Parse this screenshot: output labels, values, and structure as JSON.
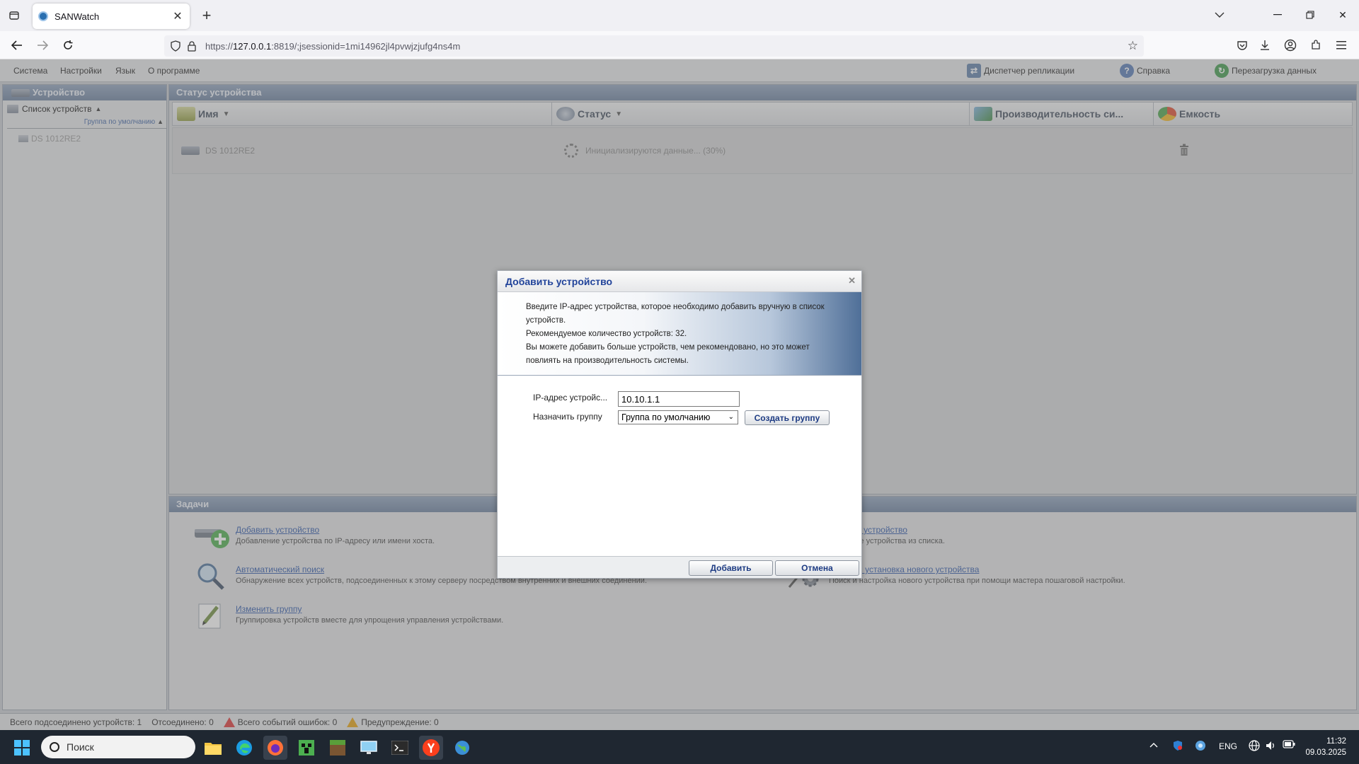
{
  "browser": {
    "tab_title": "SANWatch",
    "url_prefix": "https://",
    "url_host": "127.0.0.1",
    "url_rest": ":8819/;jsessionid=1mi14962jl4pvwjzjufg4ns4m"
  },
  "menu": {
    "items": [
      "Система",
      "Настройки",
      "Язык",
      "О программе"
    ],
    "replication": "Диспетчер репликации",
    "help": "Справка",
    "reload": "Перезагрузка данных"
  },
  "left_panel": {
    "title": "Устройство",
    "tree_root": "Список устройств",
    "group": "Группа по умолчанию",
    "device": "DS 1012RE2"
  },
  "status_panel": {
    "title": "Статус устройства",
    "columns": [
      "Имя",
      "Статус",
      "Производительность си...",
      "Емкость"
    ],
    "row": {
      "name": "DS 1012RE2",
      "status": "Инициализируются данные... (30%)"
    }
  },
  "tasks": {
    "title": "Задачи",
    "items": [
      {
        "link": "Добавить устройство",
        "desc": "Добавление устройства по IP-адресу или имени хоста."
      },
      {
        "link": "Автоматический поиск",
        "desc": "Обнаружение всех устройств, подсоединенных к этому серверу посредством внутренних и внешних соединений."
      },
      {
        "link": "Изменить группу",
        "desc": "Группировка устройств вместе для упрощения управления устройствами."
      },
      {
        "link": "Удалить устройство",
        "desc": "Удаление устройства из списка."
      },
      {
        "link": "Быстрая установка нового устройства",
        "desc": "Поиск и настройка нового устройства при помощи мастера пошаговой настройки."
      }
    ]
  },
  "statusbar": {
    "connected": "Всего подсоединено устройств: 1",
    "disconnected": "Отсоединено: 0",
    "errors": "Всего событий ошибок: 0",
    "warnings": "Предупреждение: 0"
  },
  "dialog": {
    "title": "Добавить устройство",
    "info": [
      "Введите IP-адрес устройства, которое необходимо добавить вручную в список устройств.",
      "Рекомендуемое количество устройств: 32.",
      "Вы можете добавить больше устройств, чем рекомендовано, но это может повлиять на производительность системы."
    ],
    "ip_label": "IP-адрес устройс...",
    "ip_value": "10.10.1.1",
    "group_label": "Назначить группу",
    "group_value": "Группа по умолчанию",
    "create_group": "Создать группу",
    "add": "Добавить",
    "cancel": "Отмена"
  },
  "taskbar": {
    "search_placeholder": "Поиск",
    "lang": "ENG",
    "time": "11:32",
    "date": "09.03.2025"
  },
  "colors": {
    "panel_header": "#7488a6",
    "link": "#2a55a8",
    "dialog_title": "#21439a",
    "taskbar": "#1f2731"
  }
}
